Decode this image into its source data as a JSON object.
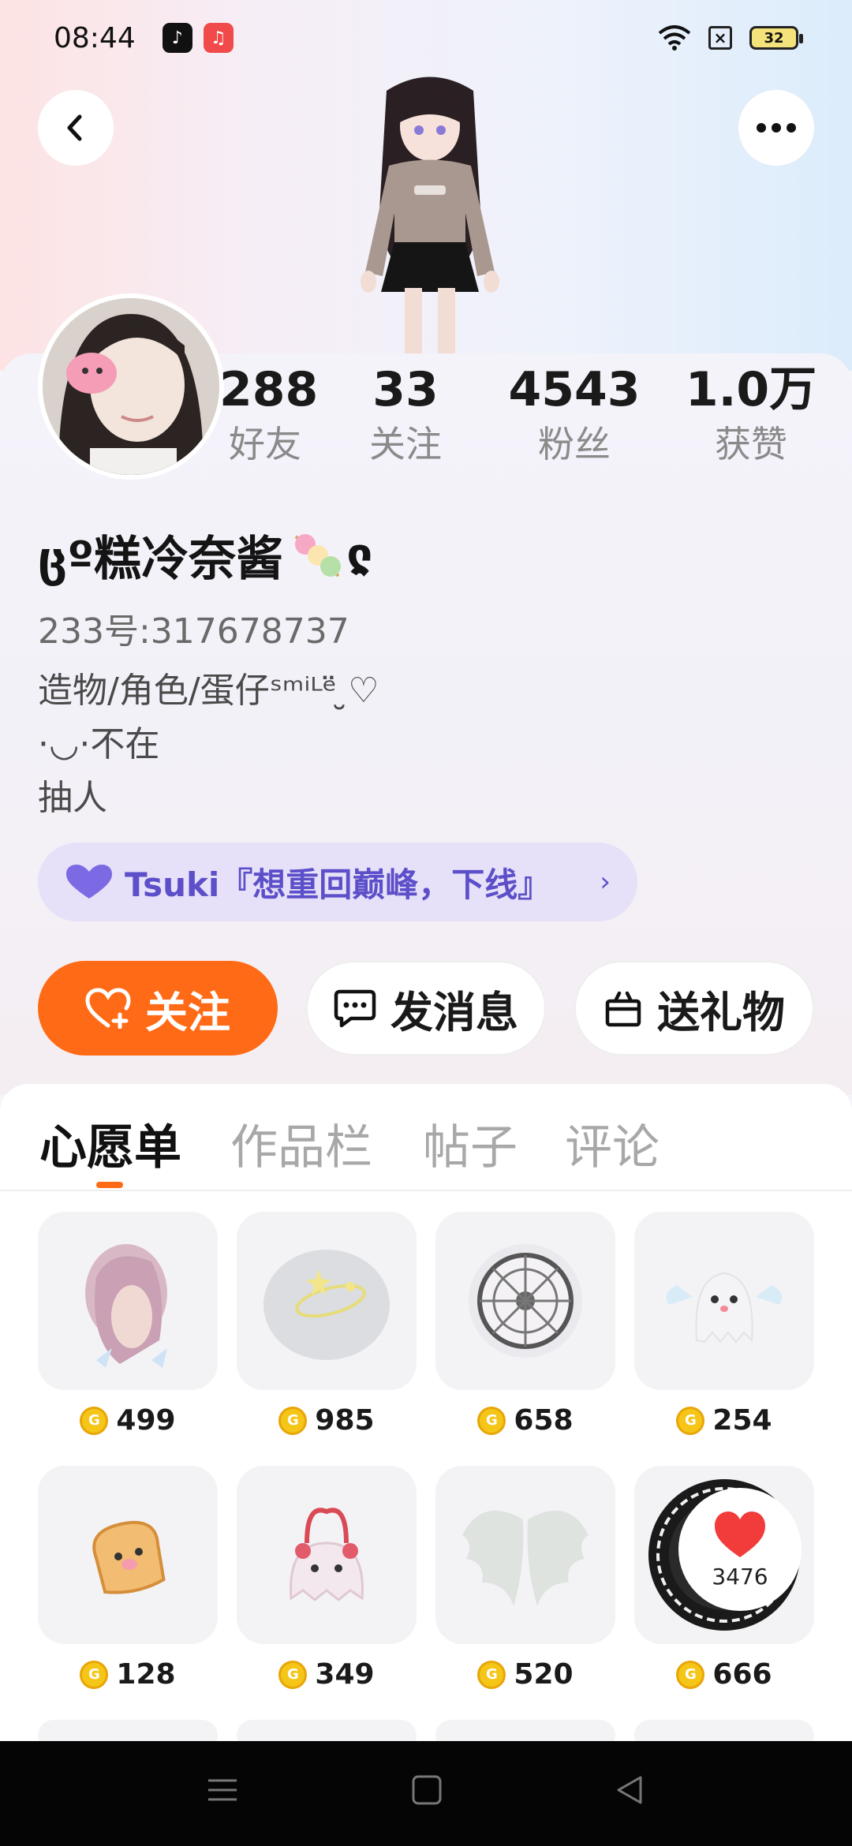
{
  "status_bar": {
    "time": "08:44",
    "battery": "32"
  },
  "profile": {
    "stats": [
      {
        "num": "288",
        "label": "好友"
      },
      {
        "num": "33",
        "label": "关注"
      },
      {
        "num": "4543",
        "label": "粉丝"
      },
      {
        "num": "1.0万",
        "label": "获赞"
      }
    ],
    "nickname": "ცº糕冷奈酱",
    "nickname_suffix": "ჺ",
    "uid": "233号:317678737",
    "bio": [
      "造物/角色/蛋仔ˢᵐⁱᴸᵉ̈ ̮♡",
      "·◡·不在",
      "抽人"
    ],
    "guild": "Tsuki『想重回巅峰，下线』"
  },
  "actions": {
    "follow": "关注",
    "message": "发消息",
    "gift": "送礼物"
  },
  "tabs": [
    "心愿单",
    "作品栏",
    "帖子",
    "评论"
  ],
  "wishlist": [
    {
      "price": "499",
      "icon": "hair-accessory-icon"
    },
    {
      "price": "985",
      "icon": "starry-cloud-icon"
    },
    {
      "price": "658",
      "icon": "magic-circle-icon"
    },
    {
      "price": "254",
      "icon": "winged-ghost-icon"
    },
    {
      "price": "128",
      "icon": "toast-bread-icon"
    },
    {
      "price": "349",
      "icon": "bunny-bag-icon"
    },
    {
      "price": "520",
      "icon": "angel-wings-icon"
    },
    {
      "price": "666",
      "icon": "rune-ring-icon",
      "badge_count": "3476"
    }
  ],
  "colors": {
    "accent": "#ff6a16",
    "guild_text": "#5c4fc9",
    "guild_bg": "#e6e1f8"
  }
}
